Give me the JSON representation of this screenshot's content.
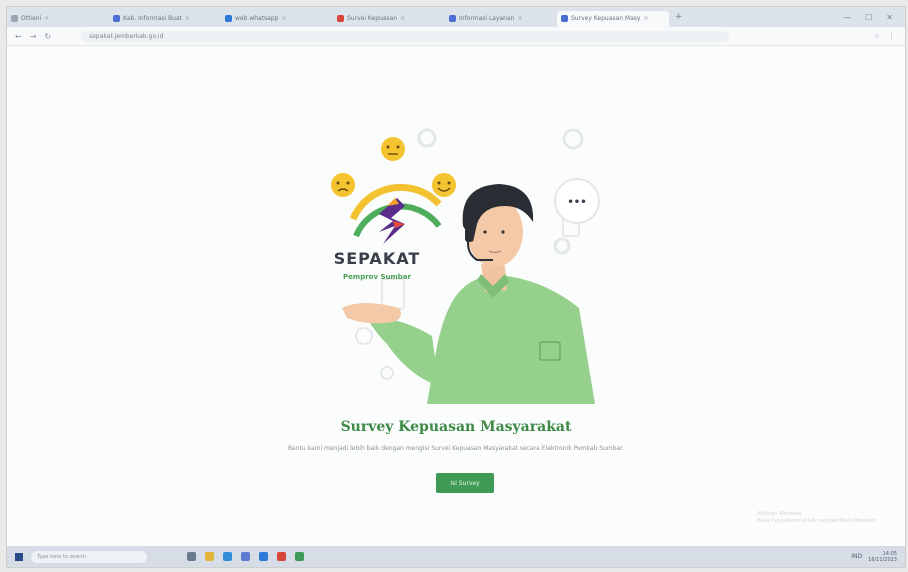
{
  "browser": {
    "tabs": [
      {
        "label": "Ottieni",
        "favicon_color": "#9aa4b2",
        "active": false
      },
      {
        "label": "Kab. Informasi Buat",
        "favicon_color": "#4a6fd1",
        "active": false
      },
      {
        "label": "web.whatsapp",
        "favicon_color": "#2f7ad8",
        "active": false
      },
      {
        "label": "Survei Kepuasan",
        "favicon_color": "#d8453a",
        "active": false
      },
      {
        "label": "Informasi Layanan",
        "favicon_color": "#4a6fd1",
        "active": false
      },
      {
        "label": "Survey Kepuasan Masy",
        "favicon_color": "#4a6fd1",
        "active": true
      }
    ],
    "new_tab": "+",
    "address": "sepakat.jemberkab.go.id",
    "nav": {
      "back": "←",
      "forward": "→",
      "reload": "↻"
    },
    "toolbar_icons": [
      "☆",
      "⋮"
    ],
    "window_controls": {
      "minimize": "—",
      "maximize": "☐",
      "close": "✕"
    }
  },
  "page": {
    "logo": {
      "name": "SEPAKAT",
      "tagline": "Pemprov Sumbar"
    },
    "speech_bubble": "•••",
    "title": "Survey Kepuasan Masyarakat",
    "subtitle": "Bantu kami menjadi lebih baik dengan mengisi Survei Kepuasan Masyarakat secara Elektronik Pemkab Sumbar.",
    "cta_label": "Isi Survey",
    "watermark": [
      "Aktifkan Windows",
      "Buka Pengaturan untuk mengaktifkan Windows."
    ],
    "colors": {
      "brand_green": "#3f9a55",
      "title_green": "#3d8a46",
      "arc_yellow": "#f2c230",
      "arc_green": "#4fae5c"
    }
  },
  "taskbar": {
    "search_placeholder": "Type here to search",
    "apps": [
      {
        "name": "task-view",
        "color": "#6b7a90"
      },
      {
        "name": "file-explorer",
        "color": "#e0b53a"
      },
      {
        "name": "edge",
        "color": "#2f8fd8"
      },
      {
        "name": "store",
        "color": "#5a7bd0"
      },
      {
        "name": "mail",
        "color": "#2f7ad8"
      },
      {
        "name": "chrome",
        "color": "#d8453a"
      },
      {
        "name": "app",
        "color": "#3f9a55"
      }
    ],
    "tray": {
      "lang": "IND",
      "time": "14:05",
      "date": "16/11/2023"
    }
  }
}
